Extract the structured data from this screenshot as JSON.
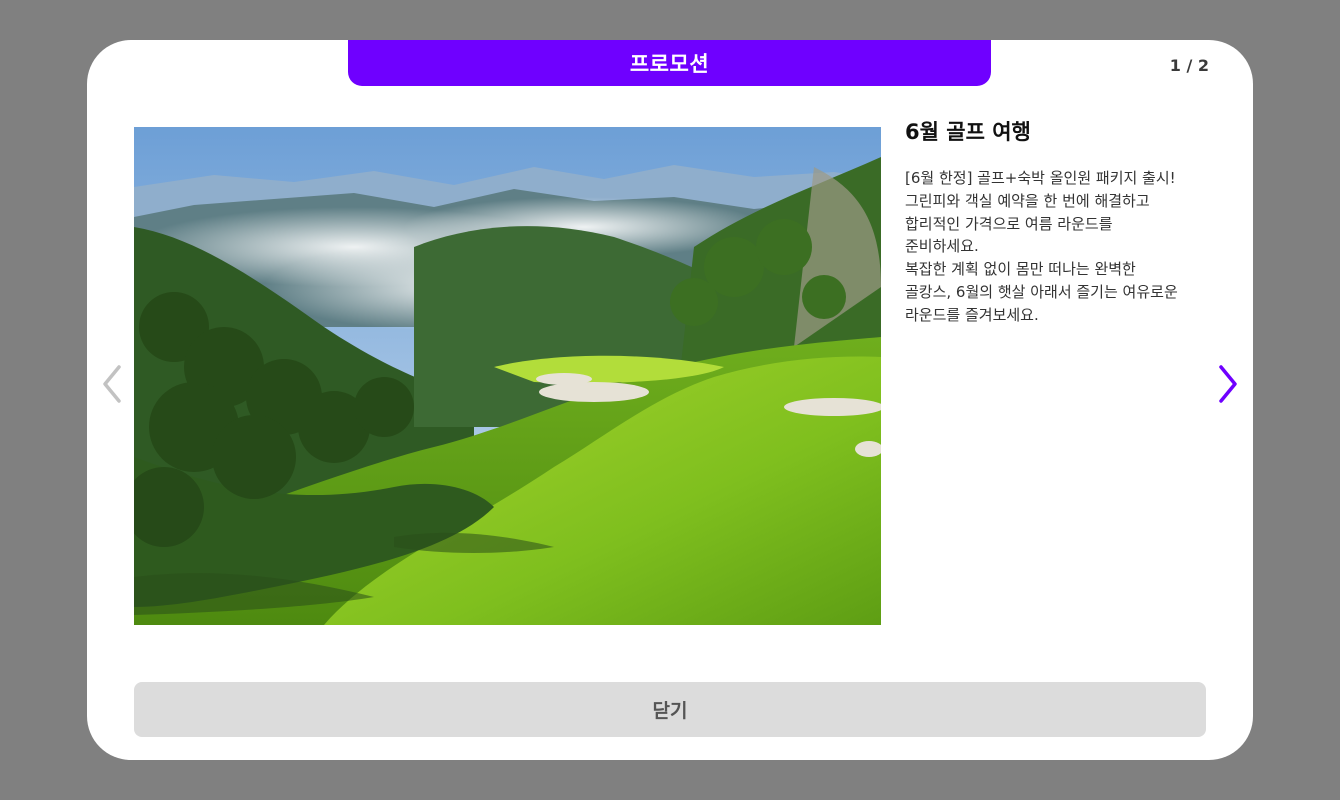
{
  "modal": {
    "title": "프로모션",
    "page_indicator": "1 / 2",
    "accent_color": "#6f00ff"
  },
  "promotion": {
    "title": "6월 골프 여행",
    "description": "[6월 한정] 골프+숙박 올인원 패키지 출시!\n그린피와 객실 예약을 한 번에 해결하고\n합리적인 가격으로 여름 라운드를\n준비하세요.\n복잡한 계획 없이 몸만 떠나는 완벽한\n골캉스, 6월의 햇살 아래서 즐기는 여유로운\n라운드를 즐겨보세요."
  },
  "navigation": {
    "prev_icon": "chevron-left-icon",
    "next_icon": "chevron-right-icon"
  },
  "pagination": {
    "total": 2,
    "current": 1
  },
  "footer": {
    "close_label": "닫기"
  }
}
